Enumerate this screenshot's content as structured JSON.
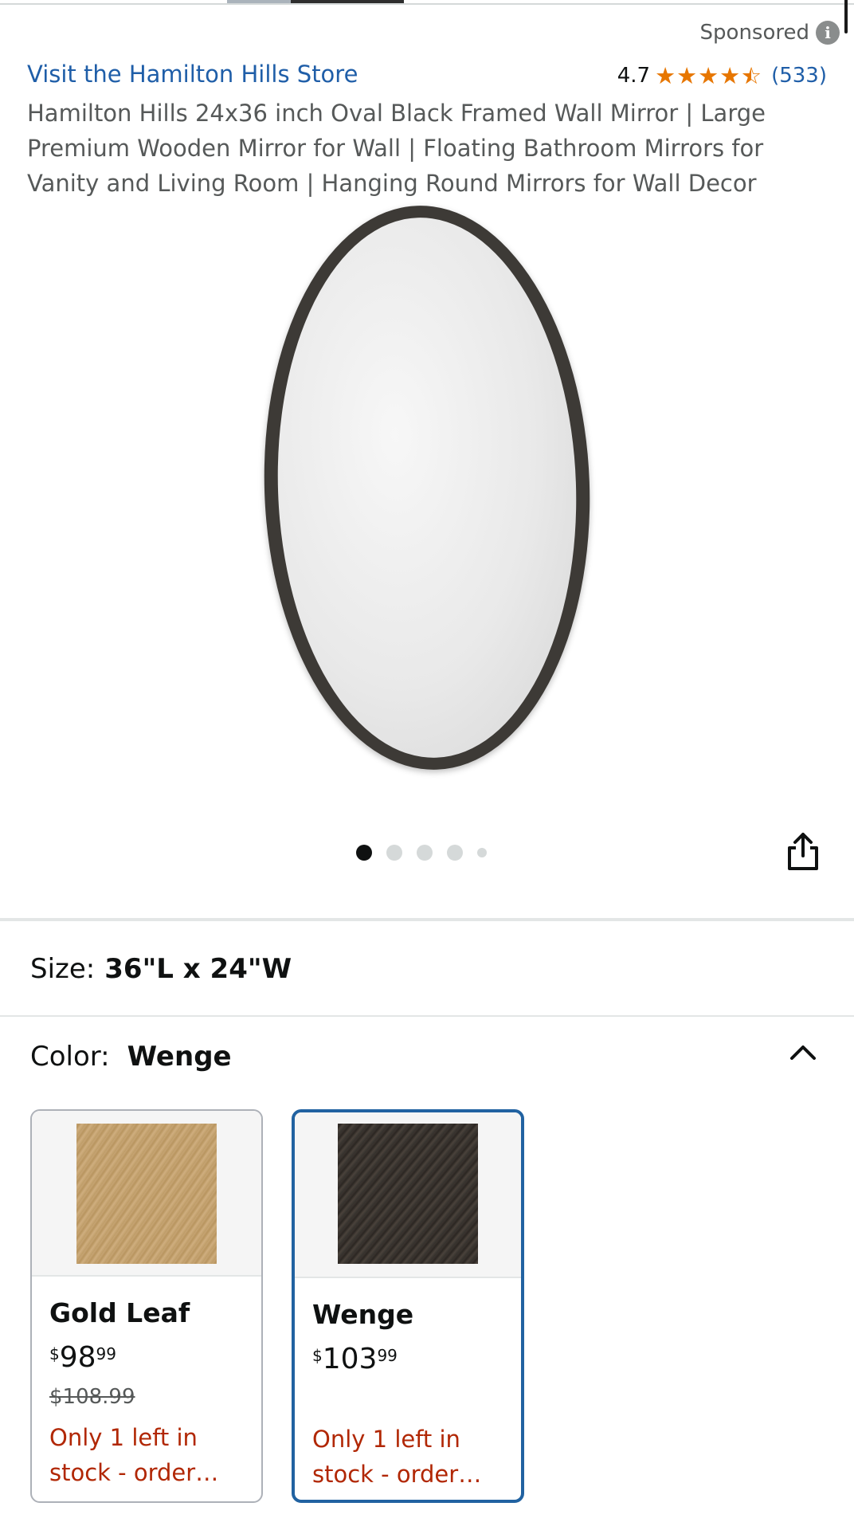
{
  "header": {
    "sponsored_label": "Sponsored",
    "info_icon_glyph": "i"
  },
  "product": {
    "store_link": "Visit the Hamilton Hills Store",
    "rating_value": "4.7",
    "rating_stars": 4.5,
    "rating_count": "(533)",
    "title": "Hamilton Hills 24x36 inch Oval Black Framed Wall Mirror | Large Premium Wooden Mirror for Wall | Floating Bathroom Mirrors for Vanity and Living Room | Hanging Round Mirrors for Wall Decor"
  },
  "gallery": {
    "image_count": 5,
    "active_index": 0
  },
  "size": {
    "label": "Size:",
    "value": "36\"L x 24\"W"
  },
  "color": {
    "label": "Color:",
    "value": "Wenge",
    "options": [
      {
        "name": "Gold Leaf",
        "currency": "$",
        "price_whole": "98",
        "price_fraction": "99",
        "list_price": "$108.99",
        "stock": "Only 1 left in stock - order…",
        "selected": false,
        "swatch_color": "#c4a26f"
      },
      {
        "name": "Wenge",
        "currency": "$",
        "price_whole": "103",
        "price_fraction": "99",
        "list_price": "",
        "stock": "Only 1 left in stock - order…",
        "selected": true,
        "swatch_color": "#3a332d"
      }
    ]
  },
  "colors": {
    "link": "#1f5ea8",
    "star": "#e77600",
    "stock_warning": "#b12704",
    "selected_border": "#2162a1"
  }
}
